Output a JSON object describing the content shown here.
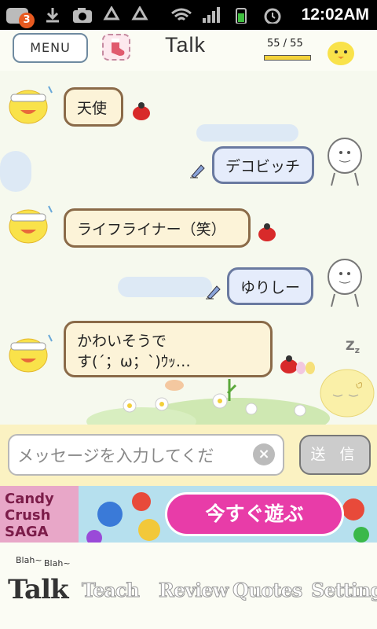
{
  "status_bar": {
    "time": "12:02AM",
    "notification_count": "3"
  },
  "header": {
    "menu_label": "MENU",
    "title": "Talk",
    "counter": "55 / 55",
    "counter_fill": 1.0
  },
  "messages": [
    {
      "side": "left",
      "text": "天使"
    },
    {
      "side": "right",
      "text": "デコビッチ"
    },
    {
      "side": "left",
      "text": "ライフライナー（笑）"
    },
    {
      "side": "right",
      "text": "ゆりしー"
    },
    {
      "side": "left",
      "text_line1": "かわいそうで",
      "text_line2": "す(´；ω；`)ｳｯ…"
    }
  ],
  "input": {
    "placeholder": "メッセージを入力してくだ",
    "send_label": "送 信"
  },
  "ad": {
    "logo_text": "Candy Crush SAGA",
    "button_label": "今すぐ遊ぶ"
  },
  "tabs": [
    {
      "label": "Talk",
      "active": true
    },
    {
      "label": "Teach",
      "active": false
    },
    {
      "label": "Review",
      "active": false
    },
    {
      "label": "Quotes",
      "active": false
    },
    {
      "label": "Setting",
      "active": false
    }
  ],
  "tab_blah": [
    "Blah~",
    "Blah~"
  ],
  "colors": {
    "left_bubble_bg": "#fcf3d8",
    "right_bubble_bg": "#e5ecfb",
    "ad_button": "#e83ca8"
  }
}
